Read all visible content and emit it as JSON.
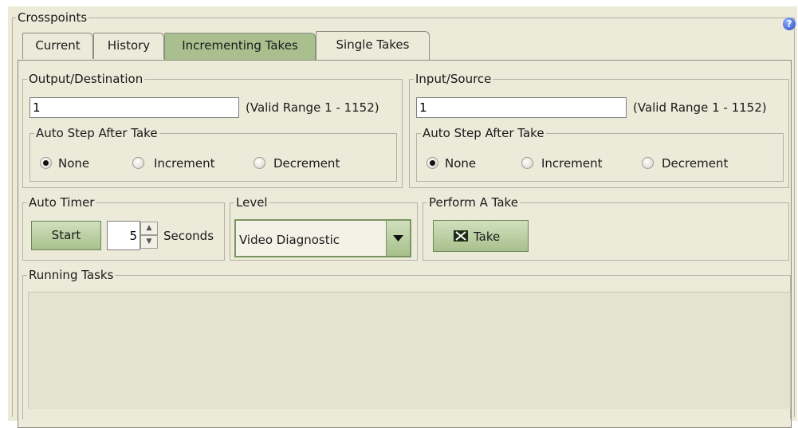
{
  "crosspoints": {
    "title": "Crosspoints"
  },
  "tabs": [
    {
      "label": "Current"
    },
    {
      "label": "History"
    },
    {
      "label": "Incrementing Takes"
    },
    {
      "label": "Single Takes"
    }
  ],
  "output": {
    "title": "Output/Destination",
    "value": "1",
    "range": "(Valid Range 1 - 1152)",
    "autostep": {
      "title": "Auto Step After Take",
      "options": [
        "None",
        "Increment",
        "Decrement"
      ],
      "selected": "None"
    }
  },
  "input": {
    "title": "Input/Source",
    "value": "1",
    "range": "(Valid Range 1 - 1152)",
    "autostep": {
      "title": "Auto Step After Take",
      "options": [
        "None",
        "Increment",
        "Decrement"
      ],
      "selected": "None"
    }
  },
  "timer": {
    "title": "Auto Timer",
    "start_label": "Start",
    "value": "5",
    "unit": "Seconds"
  },
  "level": {
    "title": "Level",
    "selected": "Video Diagnostic"
  },
  "take": {
    "title": "Perform A Take",
    "button_label": "Take"
  },
  "running": {
    "title": "Running Tasks"
  },
  "icons": {
    "help": "help-icon",
    "take": "take-crosspoint-icon",
    "dropdown": "chevron-down-icon"
  }
}
